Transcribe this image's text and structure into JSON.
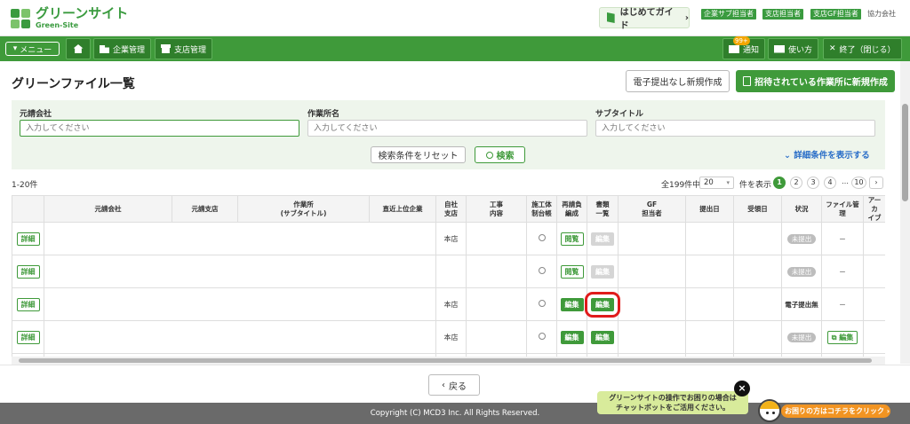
{
  "header": {
    "logo_jp": "グリーンサイト",
    "logo_en": "Green-Site",
    "guide_button": "はじめてガイド",
    "roles": [
      "企業サブ担当者",
      "支店担当者",
      "支店GF担当者"
    ],
    "company_type": "協力会社"
  },
  "nav": {
    "menu": "メニュー",
    "company_mgmt": "企業管理",
    "branch_mgmt": "支店管理",
    "notif_count": "99+",
    "notif": "通知",
    "howto": "使い方",
    "exit": "終了（閉じる）"
  },
  "page": {
    "title": "グリーンファイル一覧",
    "new_no_submit": "電子提出なし新規作成",
    "new_invited": "招待されている作業所に新規作成"
  },
  "search": {
    "contractor_label": "元請会社",
    "site_label": "作業所名",
    "subtitle_label": "サブタイトル",
    "placeholder": "入力してください",
    "reset": "検索条件をリセット",
    "search": "検索",
    "advanced": "詳細条件を表示する"
  },
  "pagination": {
    "range": "1-20件",
    "total": "全199件中",
    "per_page": "20",
    "per_page_suffix": "件を表示",
    "pages": [
      "1",
      "2",
      "3",
      "4"
    ],
    "ellipsis": "…",
    "last": "10",
    "next": "›"
  },
  "table": {
    "headers": [
      "",
      "元請会社",
      "元請支店",
      "作業所\n(サブタイトル)",
      "直近上位企業",
      "自社\n支店",
      "工事\n内容",
      "施工体\n制台帳",
      "再請負\n編成",
      "書類\n一覧",
      "GF\n担当者",
      "提出日",
      "受領日",
      "状況",
      "ファイル管理",
      "アーカ\nイブ"
    ],
    "detail_label": "詳細",
    "rows": [
      {
        "branch": "本店",
        "reorg": "閲覧",
        "docs": "編集",
        "status": "未提出",
        "file": "－"
      },
      {
        "branch": "",
        "reorg": "閲覧",
        "docs": "編集",
        "status": "未提出",
        "file": "－"
      },
      {
        "branch": "本店",
        "reorg": "編集",
        "docs": "編集",
        "status": "電子提出無",
        "file": "－"
      },
      {
        "branch": "本店",
        "reorg": "編集",
        "docs": "編集",
        "status": "未提出",
        "file": "編集"
      }
    ]
  },
  "bottom": {
    "back": "戻る",
    "copyright": "Copyright (C) MCD3 Inc. All Rights Reserved.",
    "chat_line1": "グリーンサイトの操作でお困りの場合は",
    "chat_line2": "チャットボットをご活用ください。",
    "chat_cta": "お困りの方はコチラをクリック ›",
    "chat_close": "×"
  },
  "colors": {
    "brand_green": "#3f9a3a",
    "highlight_red": "#e01b1b",
    "link_blue": "#2a6ec8"
  }
}
